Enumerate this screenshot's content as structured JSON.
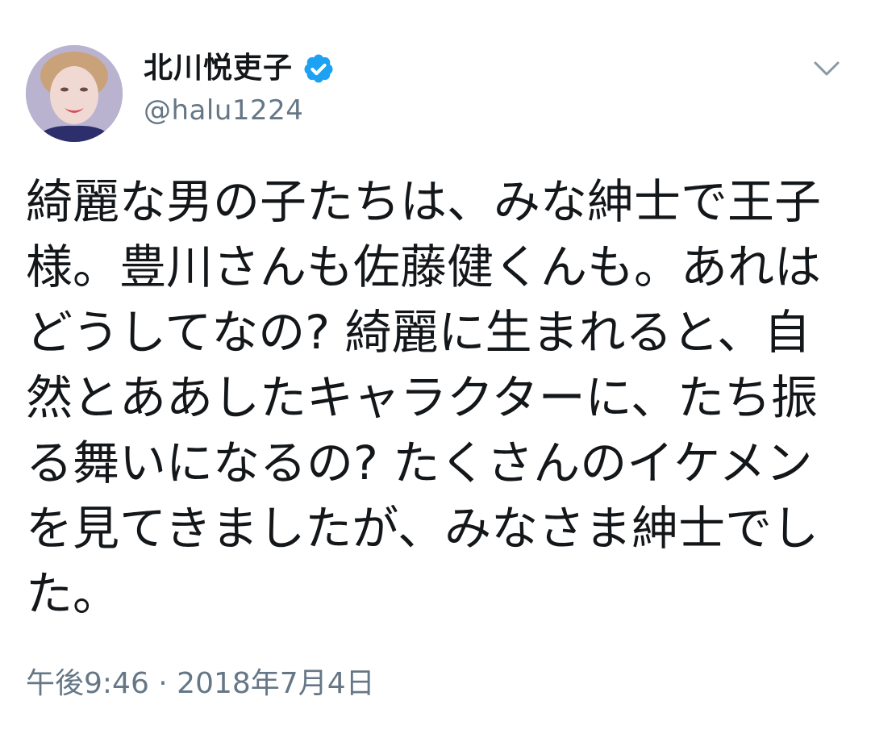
{
  "user": {
    "display_name": "北川悦吏子",
    "handle": "@halu1224",
    "verified_icon": "verified-badge-icon",
    "avatar_icon": "avatar"
  },
  "header": {
    "menu_icon": "chevron-down-icon"
  },
  "tweet": {
    "text": "綺麗な男の子たちは、みな紳士で王子様。豊川さんも佐藤健くんも。あれはどうしてなの? 綺麗に生まれると、自然とああしたキャラクターに、たち振る舞いになるの? たくさんのイケメンを見てきましたが、みなさま紳士でした。",
    "timestamp": "午後9:46 · 2018年7月4日"
  },
  "colors": {
    "text_primary": "#14171a",
    "text_secondary": "#657786",
    "verified_blue": "#1da1f2",
    "background": "#ffffff"
  }
}
